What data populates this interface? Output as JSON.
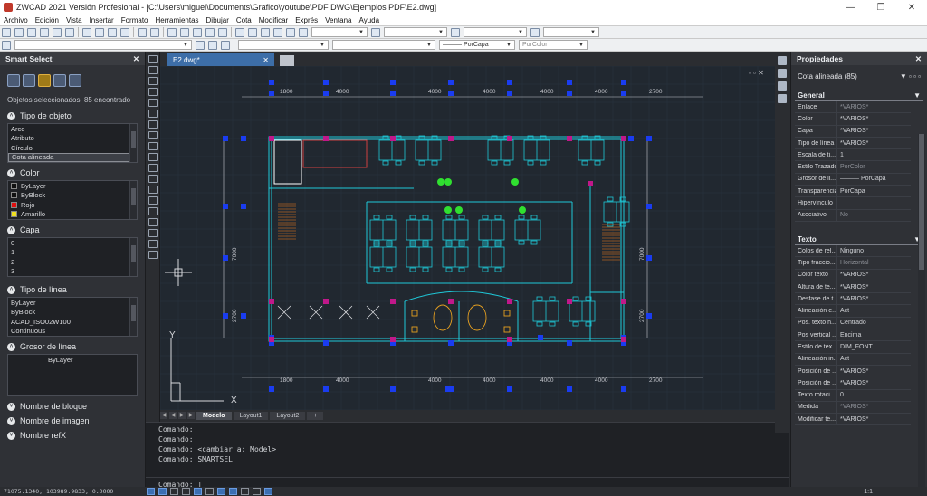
{
  "window": {
    "title": "ZWCAD 2021 Versión Profesional - [C:\\Users\\miguel\\Documents\\Grafico\\youtube\\PDF DWG\\Ejemplos PDF\\E2.dwg]",
    "minimize": "—",
    "maximize": "❐",
    "close": "✕"
  },
  "menu": [
    "Archivo",
    "Edición",
    "Vista",
    "Insertar",
    "Formato",
    "Herramientas",
    "Dibujar",
    "Cota",
    "Modificar",
    "Exprés",
    "Ventana",
    "Ayuda"
  ],
  "toolbar": {
    "linetype": "PorCapa",
    "color": "PorColor"
  },
  "left_panel": {
    "title": "Smart Select",
    "close": "✕",
    "objects_line": "Objetos seleccionados: 85 encontrado",
    "sections": {
      "object_type": {
        "label": "Tipo de objeto",
        "items": [
          "Arco",
          "Atributo",
          "Círculo",
          "Cota alineada"
        ],
        "selected": "Cota alineada"
      },
      "color": {
        "label": "Color",
        "items": [
          {
            "name": "ByLayer",
            "swatch": "#111111"
          },
          {
            "name": "ByBlock",
            "swatch": "#111111"
          },
          {
            "name": "Rojo",
            "swatch": "#e01010"
          },
          {
            "name": "Amarillo",
            "swatch": "#f0e020"
          }
        ]
      },
      "layer": {
        "label": "Capa",
        "items": [
          "0",
          "1",
          "2",
          "3"
        ]
      },
      "linetype": {
        "label": "Tipo de línea",
        "items": [
          "ByLayer",
          "ByBlock",
          "ACAD_ISO02W100",
          "Continuous"
        ]
      },
      "lineweight": {
        "label": "Grosor de línea",
        "items": [
          "ByLayer"
        ]
      },
      "block_name": {
        "label": "Nombre de bloque"
      },
      "image_name": {
        "label": "Nombre de imagen"
      },
      "refx_name": {
        "label": "Nombre refX"
      }
    }
  },
  "drawing": {
    "tab_label": "E2.dwg*",
    "tab_close": "✕",
    "window_controls": "▫ ▫ ✕",
    "dims_top": [
      "1800",
      "4000",
      "4000",
      "4000",
      "4000",
      "4000",
      "2700"
    ],
    "dims_bottom": [
      "1800",
      "4000",
      "4000",
      "4000",
      "4000",
      "4000",
      "2700"
    ],
    "dims_left": [
      "7000",
      "2700"
    ],
    "dims_right": [
      "7000",
      "2700"
    ],
    "ucs_x": "X",
    "ucs_y": "Y",
    "layout_tabs": [
      "Modelo",
      "Layout1",
      "Layout2",
      "+"
    ],
    "active_layout": "Modelo"
  },
  "command": {
    "history": [
      "Comando:",
      "Comando:",
      "Comando: <cambiar a: Model>",
      "Comando: SMARTSEL"
    ],
    "prompt": "Comando:"
  },
  "status": {
    "coords": "71075.1340, 103989.9833, 0.0000",
    "scale": "1:1"
  },
  "properties": {
    "title": "Propiedades",
    "close": "✕",
    "selection": "Cota alineada (85)",
    "general_label": "General",
    "general": [
      {
        "k": "Enlace",
        "v": "*VARIOS*",
        "dim": true
      },
      {
        "k": "Color",
        "v": "*VARIOS*",
        "dim": false
      },
      {
        "k": "Capa",
        "v": "*VARIOS*",
        "dim": false
      },
      {
        "k": "Tipo de línea",
        "v": "*VARIOS*",
        "dim": false
      },
      {
        "k": "Escala de ti...",
        "v": "1",
        "dim": false
      },
      {
        "k": "Estilo Trazado",
        "v": "PorColor",
        "dim": true
      },
      {
        "k": "Grosor de li...",
        "v": "——— PorCapa",
        "dim": false
      },
      {
        "k": "Transparencia",
        "v": "PorCapa",
        "dim": false
      },
      {
        "k": "Hipervínculo",
        "v": "",
        "dim": false
      },
      {
        "k": "Asociativo",
        "v": "No",
        "dim": true
      }
    ],
    "text_label": "Texto",
    "text": [
      {
        "k": "Colos de rel...",
        "v": "Ninguno",
        "dim": false
      },
      {
        "k": "Tipo fraccio...",
        "v": "Horizontal",
        "dim": true
      },
      {
        "k": "Color texto",
        "v": "*VARIOS*",
        "dim": false
      },
      {
        "k": "Altura de te...",
        "v": "*VARIOS*",
        "dim": false
      },
      {
        "k": "Desfase de t...",
        "v": "*VARIOS*",
        "dim": false
      },
      {
        "k": "Alineación e...",
        "v": "Act",
        "dim": false
      },
      {
        "k": "Pos. texto h...",
        "v": "Centrado",
        "dim": false
      },
      {
        "k": "Pos vertical ...",
        "v": "Encima",
        "dim": false
      },
      {
        "k": "Estilo de tex...",
        "v": "DIM_FONT",
        "dim": false
      },
      {
        "k": "Alineación in...",
        "v": "Act",
        "dim": false
      },
      {
        "k": "Posición de ...",
        "v": "*VARIOS*",
        "dim": false
      },
      {
        "k": "Posición de ...",
        "v": "*VARIOS*",
        "dim": false
      },
      {
        "k": "Texto rotaci...",
        "v": "0",
        "dim": false
      },
      {
        "k": "Medida",
        "v": "*VARIOS*",
        "dim": true
      },
      {
        "k": "Modificar te...",
        "v": "*VARIOS*",
        "dim": false
      }
    ]
  },
  "colors": {
    "walls": "#1fc8d8",
    "grips_blue": "#1a3cf0",
    "grips_magenta": "#c0188a",
    "furniture": "#e6a020",
    "stairs": "#b06020",
    "accent_red": "#d04040",
    "green": "#30e030"
  }
}
